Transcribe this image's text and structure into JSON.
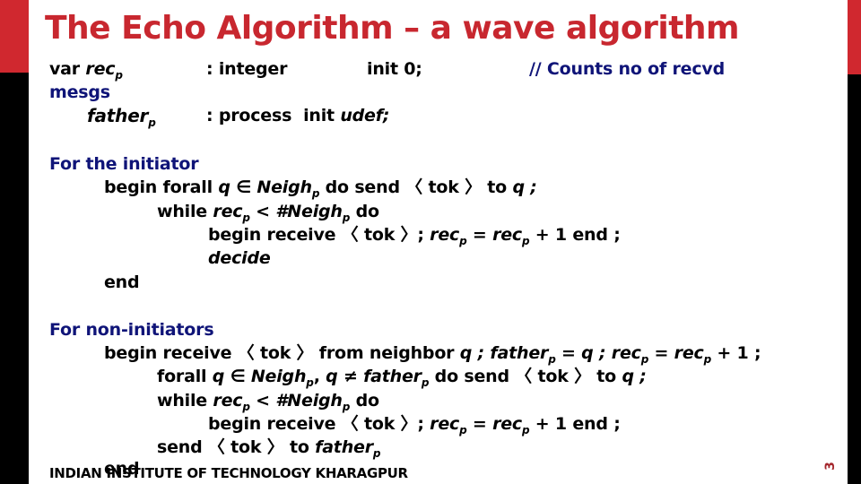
{
  "slide": {
    "title": "The Echo Algorithm – a wave algorithm",
    "page_number": "3",
    "footer": "INDIAN INSTITUTE OF TECHNOLOGY KHARAGPUR",
    "colors": {
      "accent_red": "#d0282f",
      "title_red": "#c8272f",
      "heading_blue": "#0f1478",
      "bar_black": "#000000"
    }
  },
  "declarations": {
    "var_kw": "var",
    "rec": "rec",
    "sub_p": "p",
    "rec_type": ": integer",
    "rec_init": "init 0;",
    "comment": "// Counts no of recvd",
    "mesgs": "mesgs",
    "father": "father",
    "father_type": ": process",
    "father_init_kw": "init",
    "father_init_val": "udef",
    "semicolon": ";"
  },
  "initiator": {
    "heading": "For the initiator",
    "l1_a": "begin forall",
    "q": "q",
    "in": "∈",
    "neigh": "Neigh",
    "l1_b": "do send 〈 tok 〉 to",
    "semi": ";",
    "l2_a": "while",
    "lt_hash_neigh": "< #Neigh",
    "do": "do",
    "l3_a": "begin receive 〈 tok 〉;",
    "eq": "=",
    "plus_one_end": "+ 1 end ;",
    "decide": "decide",
    "end": "end"
  },
  "non_initiator": {
    "heading": "For non-initiators",
    "l1_a": "begin receive 〈 tok 〉 from neighbor",
    "father_eq": "= q ;",
    "rec_eq": "=",
    "plus_one": "+ 1 ;",
    "l2_a": "forall",
    "neq": "q ≠",
    "l2_b": "do send 〈 tok 〉 to",
    "l4_send": "send 〈 tok 〉 to",
    "end": "end"
  }
}
